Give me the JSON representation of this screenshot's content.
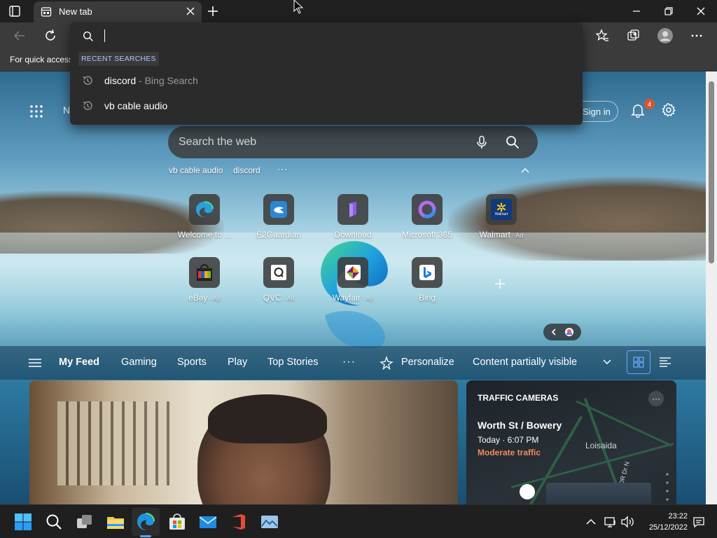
{
  "window": {
    "tab_title": "New tab",
    "favorites_bar_text": "For quick access"
  },
  "omnibox": {
    "recent_label": "RECENT SEARCHES",
    "items": [
      {
        "query": "discord",
        "source": " - Bing Search"
      },
      {
        "query": "vb cable audio",
        "source": ""
      }
    ]
  },
  "newtab": {
    "header_partial": "N",
    "signin_label": "Sign in",
    "notification_count": "4",
    "search_placeholder": "Search the web",
    "suggestions": [
      "vb cable audio",
      "discord"
    ],
    "suggestions_more": "···",
    "quick_links_row1": [
      {
        "label": "Welcome to ...",
        "ad": ""
      },
      {
        "label": "E2Guardian",
        "ad": ""
      },
      {
        "label": "Download",
        "ad": ""
      },
      {
        "label": "Microsoft 365",
        "ad": ""
      },
      {
        "label": "Walmart",
        "ad": " · Ad"
      }
    ],
    "quick_links_row2": [
      {
        "label": "eBay",
        "ad": " · Ad"
      },
      {
        "label": "QVC",
        "ad": " · Ad"
      },
      {
        "label": "Wayfair",
        "ad": " · Ad"
      },
      {
        "label": "Bing",
        "ad": ""
      }
    ],
    "walmart_logo_text": "Walmart"
  },
  "feed": {
    "tabs": [
      "My Feed",
      "Gaming",
      "Sports",
      "Play",
      "Top Stories"
    ],
    "more": "···",
    "personalize": "Personalize",
    "visibility": "Content partially visible"
  },
  "traffic_card": {
    "header": "TRAFFIC CAMERAS",
    "location": "Worth St / Bowery",
    "time": "Today · 6:07 PM",
    "status": "Moderate traffic",
    "map_area": "Loisaida",
    "map_street": "FDR Dr N",
    "menu": "···"
  },
  "taskbar": {
    "time": "23:22",
    "date": "25/12/2022"
  },
  "colors": {
    "accent": "#5ea3e8",
    "badge": "#d7562f",
    "traffic_status": "#f08a5d"
  }
}
